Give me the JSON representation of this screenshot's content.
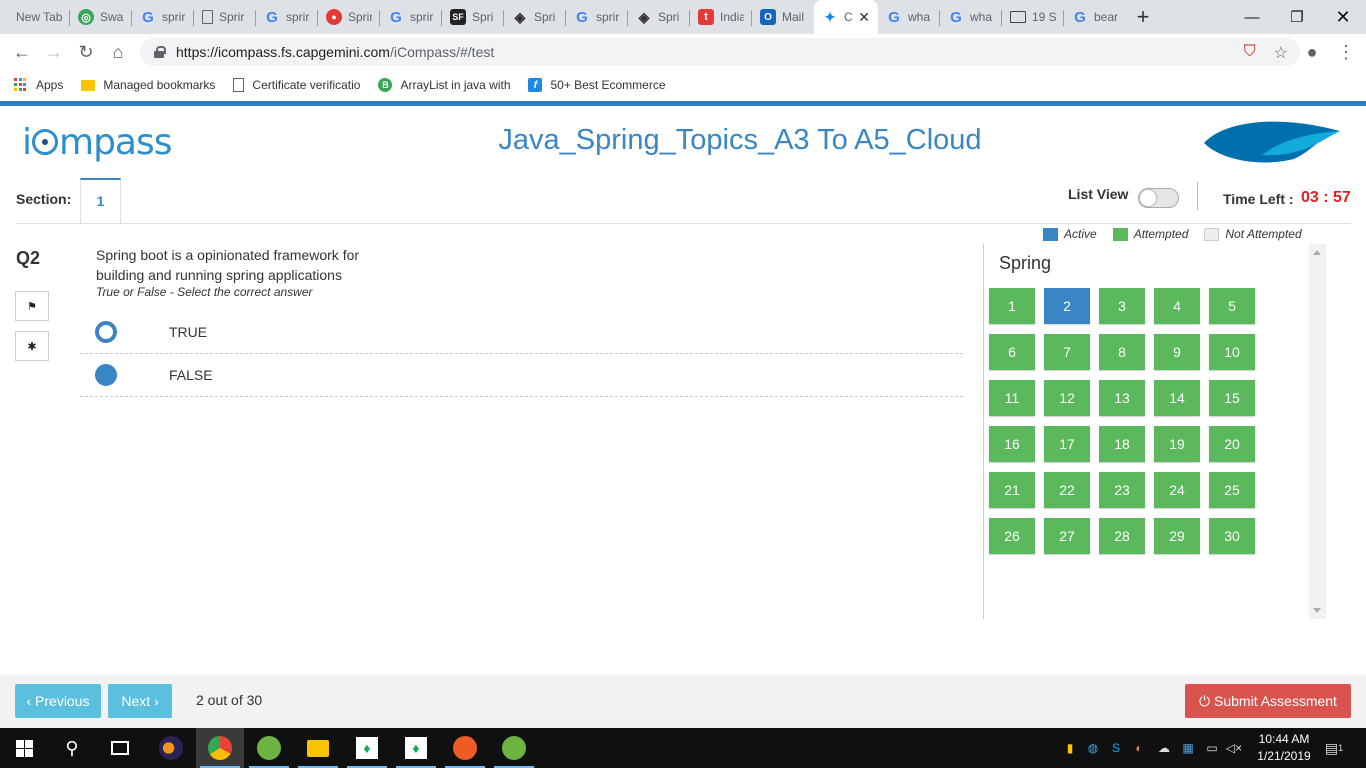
{
  "browser": {
    "tabs": [
      {
        "title": "New Tab",
        "icon": "none"
      },
      {
        "title": "Swa",
        "icon": "green-circle-icon"
      },
      {
        "title": "sprir",
        "icon": "google-icon"
      },
      {
        "title": "Sprir",
        "icon": "document-icon"
      },
      {
        "title": "sprir",
        "icon": "google-icon"
      },
      {
        "title": "Sprir",
        "icon": "red-circle-icon"
      },
      {
        "title": "sprir",
        "icon": "google-icon"
      },
      {
        "title": "Spri",
        "icon": "sf-icon"
      },
      {
        "title": "Spri",
        "icon": "diamond-icon"
      },
      {
        "title": "sprir",
        "icon": "google-icon"
      },
      {
        "title": "Spri",
        "icon": "diamond-icon"
      },
      {
        "title": "India",
        "icon": "t-icon"
      },
      {
        "title": "Mail",
        "icon": "outlook-icon"
      },
      {
        "title": "C",
        "icon": "icompass-icon"
      },
      {
        "title": "wha",
        "icon": "google-icon"
      },
      {
        "title": "wha",
        "icon": "google-icon"
      },
      {
        "title": "19 S",
        "icon": "book-icon"
      },
      {
        "title": "bear",
        "icon": "google-icon"
      }
    ],
    "url_host": "https://icompass.fs.capgemini.com",
    "url_path": "/iCompass/#/test",
    "bookmarks": [
      {
        "label": "Apps"
      },
      {
        "label": "Managed bookmarks"
      },
      {
        "label": "Certificate verificatio"
      },
      {
        "label": "ArrayList in java with"
      },
      {
        "label": "50+ Best Ecommerce"
      }
    ]
  },
  "header": {
    "logo_text_pre": "i",
    "logo_text_post": "mpass",
    "title": "Java_Spring_Topics_A3 To A5_Cloud"
  },
  "section": {
    "label": "Section:",
    "tab": "1",
    "list_view_label": "List View",
    "time_left_label": "Time Left :",
    "time_left_value": "03 : 57"
  },
  "question": {
    "number": "Q2",
    "text": "Spring boot is a opinionated framework for building and running spring applications",
    "hint": "True or False - Select the correct answer",
    "options": [
      {
        "label": "TRUE",
        "selected": false
      },
      {
        "label": "FALSE",
        "selected": true
      }
    ]
  },
  "legend": {
    "active": "Active",
    "attempted": "Attempted",
    "not_attempted": "Not Attempted",
    "colors": {
      "active": "#3a86c4",
      "attempted": "#5cb85c",
      "not_attempted": "#eeeeee"
    }
  },
  "palette": {
    "title": "Spring",
    "active_question": 2,
    "questions": [
      "1",
      "2",
      "3",
      "4",
      "5",
      "6",
      "7",
      "8",
      "9",
      "10",
      "11",
      "12",
      "13",
      "14",
      "15",
      "16",
      "17",
      "18",
      "19",
      "20",
      "21",
      "22",
      "23",
      "24",
      "25",
      "26",
      "27",
      "28",
      "29",
      "30"
    ]
  },
  "footer": {
    "previous": "‹ Previous",
    "next": "Next ›",
    "count": "2 out of 30",
    "submit": "⏻ Submit Assessment"
  },
  "taskbar": {
    "time": "10:44 AM",
    "date": "1/21/2019",
    "notifications": "1"
  }
}
